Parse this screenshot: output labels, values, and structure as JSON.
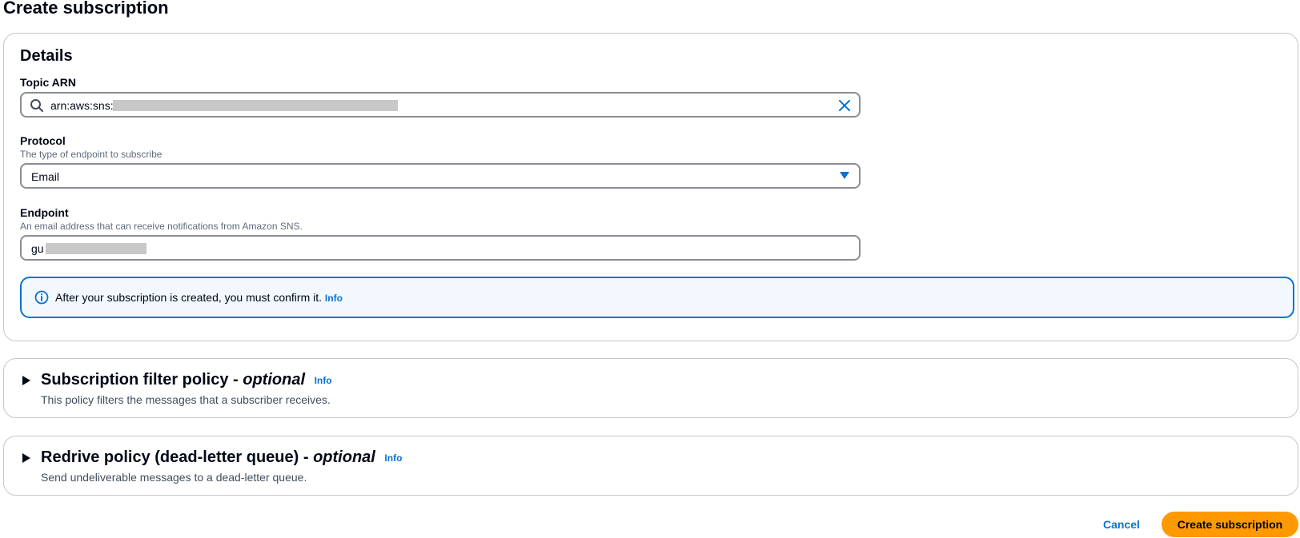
{
  "page": {
    "title": "Create subscription"
  },
  "details": {
    "title": "Details",
    "topic_arn": {
      "label": "Topic ARN",
      "value": "arn:aws:sns:u"
    },
    "protocol": {
      "label": "Protocol",
      "description": "The type of endpoint to subscribe",
      "selected": "Email"
    },
    "endpoint": {
      "label": "Endpoint",
      "description": "An email address that can receive notifications from Amazon SNS.",
      "value": "gu"
    },
    "alert": {
      "text": "After your subscription is created, you must confirm it.",
      "info": "Info"
    }
  },
  "filter_policy": {
    "title": "Subscription filter policy - ",
    "optional": "optional",
    "info": "Info",
    "description": "This policy filters the messages that a subscriber receives."
  },
  "redrive_policy": {
    "title": "Redrive policy (dead-letter queue) - ",
    "optional": "optional",
    "info": "Info",
    "description": "Send undeliverable messages to a dead-letter queue."
  },
  "actions": {
    "cancel": "Cancel",
    "create": "Create subscription"
  },
  "colors": {
    "link": "#0972d3",
    "primary_button": "#ff9900",
    "alert_bg": "#f2f8fd",
    "border": "#c6c6cd"
  },
  "icons": {
    "search": "search-icon",
    "clear": "close-icon",
    "dropdown": "caret-down-icon",
    "info": "info-icon",
    "expand": "caret-right-icon"
  }
}
